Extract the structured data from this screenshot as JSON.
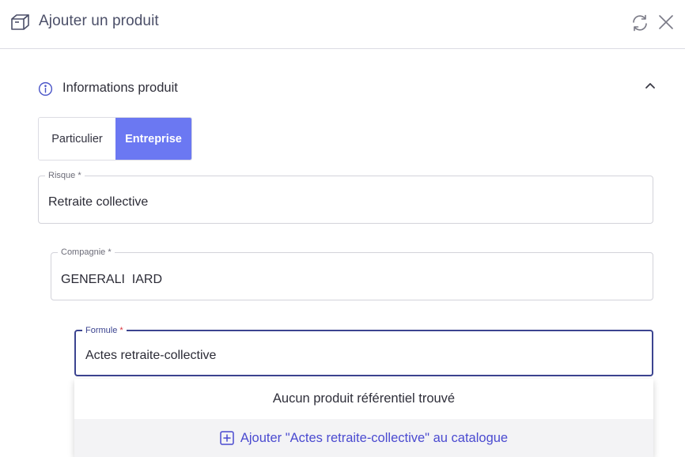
{
  "header": {
    "title": "Ajouter un produit",
    "icons": {
      "title_icon": "box-icon",
      "refresh": "refresh-icon",
      "close": "close-icon"
    }
  },
  "section": {
    "title": "Informations produit",
    "icons": {
      "info": "info-icon",
      "collapse": "chevron-up-icon"
    }
  },
  "client_type": {
    "options": [
      "Particulier",
      "Entreprise"
    ],
    "selected": "Entreprise"
  },
  "fields": {
    "risque": {
      "label": "Risque",
      "required_mark": "*",
      "value": "Retraite collective"
    },
    "compagnie": {
      "label": "Compagnie",
      "required_mark": "*",
      "value": "GENERALI  IARD"
    },
    "formule": {
      "label": "Formule",
      "required_mark": "*",
      "value": "Actes retraite-collective"
    }
  },
  "dropdown": {
    "empty_message": "Aucun produit référentiel trouvé",
    "add_action_label": "Ajouter \"Actes retraite-collective\" au catalogue",
    "add_icon": "plus-square-icon"
  },
  "colors": {
    "accent": "#6b78f2",
    "focus_border": "#3c4490",
    "link": "#4a4ad0",
    "required": "#d9343e"
  }
}
